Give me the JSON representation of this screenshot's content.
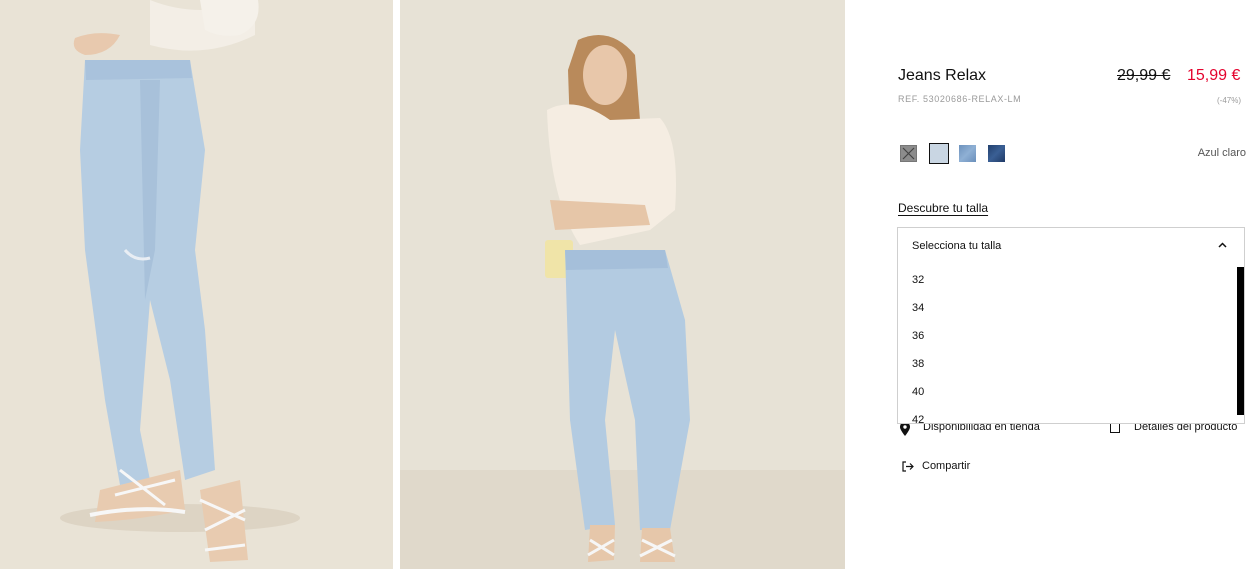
{
  "product": {
    "title": "Jeans Relax",
    "reference": "REF. 53020686-RELAX-LM",
    "old_price": "29,99 €",
    "new_price": "15,99 €",
    "discount": "(-47%)"
  },
  "colors": {
    "selected_name": "Azul claro",
    "swatches": [
      "unavailable",
      "light-blue",
      "medium-blue",
      "dark-blue"
    ]
  },
  "size_guide_label": "Descubre tu talla",
  "size_select": {
    "label": "Selecciona tu talla",
    "options": [
      "32",
      "34",
      "36",
      "38",
      "40",
      "42"
    ]
  },
  "actions": {
    "availability": "Disponibilidad en tienda",
    "details": "Detalles del producto",
    "share": "Compartir"
  }
}
